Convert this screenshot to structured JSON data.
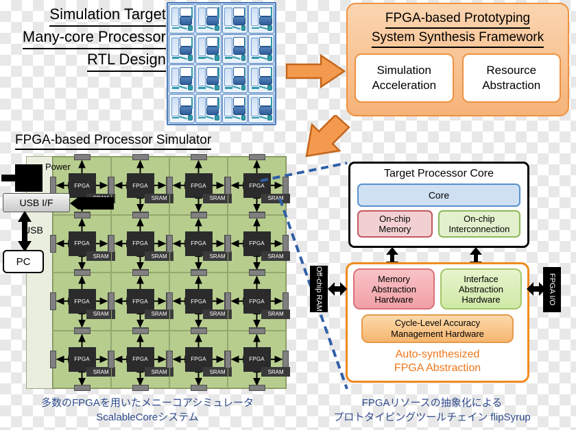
{
  "top_left": {
    "title_lines": [
      "Simulation Target",
      "Many-core Processor",
      "RTL Design"
    ]
  },
  "framework": {
    "title_lines": [
      "FPGA-based Prototyping",
      "System Synthesis Framework"
    ],
    "sub_boxes": [
      {
        "lines": [
          "Simulation",
          "Acceleration"
        ]
      },
      {
        "lines": [
          "Resource",
          "Abstraction"
        ]
      }
    ]
  },
  "simulator": {
    "title": "FPGA-based Processor Simulator",
    "power_label": "Power",
    "usb_if_label": "USB I/F",
    "usb_label": "USB",
    "pc_label": "PC",
    "cell_chip_label": "FPGA",
    "cell_mem_label": "SRAM",
    "grid_rows": 4,
    "grid_cols": 4
  },
  "target_core": {
    "title": "Target Processor Core",
    "core_label": "Core",
    "onchip_memory_lines": [
      "On-chip",
      "Memory"
    ],
    "onchip_interconnection_lines": [
      "On-chip",
      "Interconnection"
    ]
  },
  "abstraction": {
    "memory_abstraction_lines": [
      "Memory",
      "Abstraction",
      "Hardware"
    ],
    "interface_abstraction_lines": [
      "Interface",
      "Abstraction",
      "Hardware"
    ],
    "cycle_level_lines": [
      "Cycle-Level Accuracy",
      "Management Hardware"
    ],
    "footer_lines": [
      "Auto-synthesized",
      "FPGA Abstraction"
    ],
    "offchip_ram_label": "Off-chip RAM",
    "fpga_io_label": "FPGA I/O"
  },
  "captions": {
    "left_lines": [
      "多数のFPGAを用いたメニーコアシミュレータ",
      "ScalableCoreシステム"
    ],
    "right_lines": [
      "FPGAリソースの抽象化による",
      "プロトタイピングツールチェイン flipSyrup"
    ]
  },
  "colors": {
    "orange_border": "#ef9140",
    "orange_text": "#f0761a",
    "green_board": "#b7cd8e",
    "blue_die": "#cfe3f7",
    "caption_blue": "#2f4a8c",
    "dashed_blue": "#2f5fa8"
  }
}
